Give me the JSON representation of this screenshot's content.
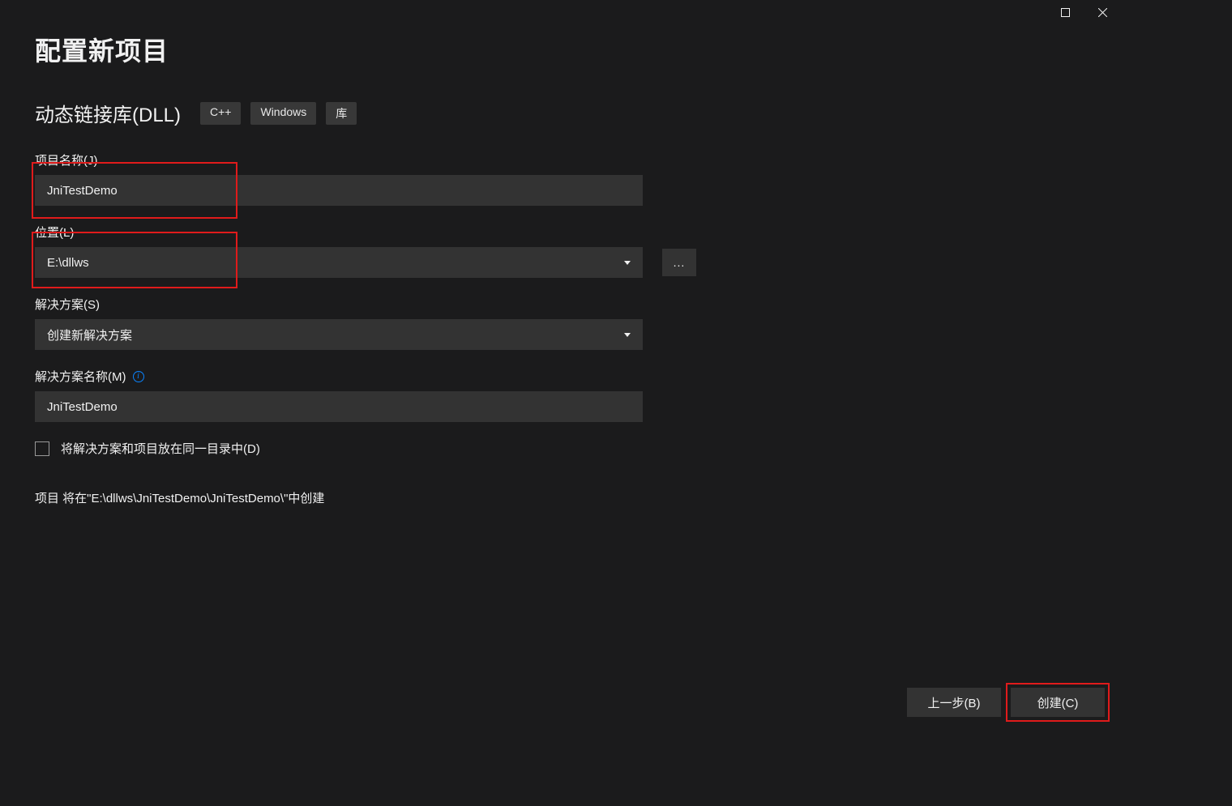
{
  "title": "配置新项目",
  "subtitle": "动态链接库(DLL)",
  "tags": [
    "C++",
    "Windows",
    "库"
  ],
  "fields": {
    "projectName": {
      "label": "项目名称(J)",
      "value": "JniTestDemo"
    },
    "location": {
      "label": "位置(L)",
      "value": "E:\\dllws",
      "browse": "..."
    },
    "solution": {
      "label": "解决方案(S)",
      "value": "创建新解决方案"
    },
    "solutionName": {
      "label": "解决方案名称(M)",
      "value": "JniTestDemo"
    }
  },
  "checkbox": {
    "label": "将解决方案和项目放在同一目录中(D)"
  },
  "hint": "项目 将在\"E:\\dllws\\JniTestDemo\\JniTestDemo\\\"中创建",
  "footer": {
    "back": "上一步(B)",
    "create": "创建(C)"
  }
}
